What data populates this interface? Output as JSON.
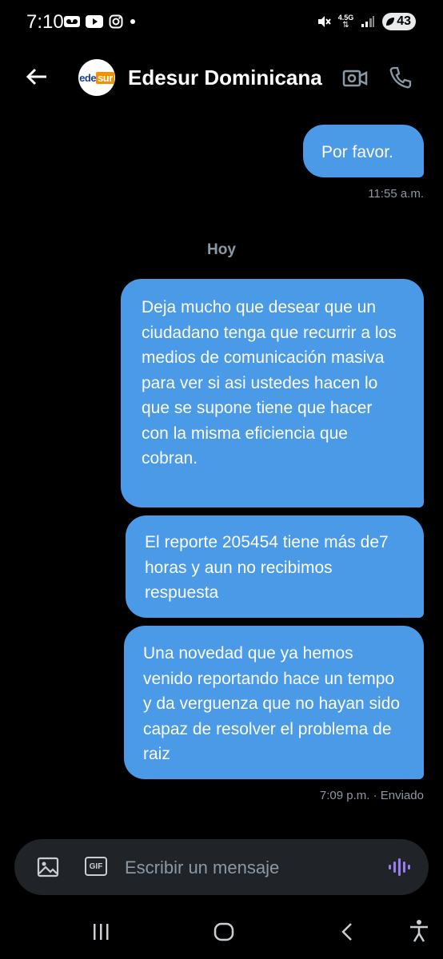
{
  "status_bar": {
    "time": "7:10",
    "network": "4.5G",
    "battery": "43",
    "icons": [
      "voicemail-icon",
      "youtube-icon",
      "instagram-icon",
      "dot-icon",
      "mute-icon",
      "signal-icon",
      "battery-icon"
    ]
  },
  "header": {
    "avatar_text_1": "ede",
    "avatar_text_2": "sur",
    "title": "Edesur Dominicana",
    "accent": "#f39200",
    "brand_blue": "#1f3f8f"
  },
  "messages": [
    {
      "text": "Por favor.",
      "meta": "11:55 a.m."
    },
    {
      "text": "Deja mucho que desear que un ciudadano tenga que recurrir a los medios de comunicación masiva para ver si asi ustedes hacen lo que se supone tiene que hacer con la misma eficiencia que cobran."
    },
    {
      "text": "El reporte 205454 tiene más de7 horas y aun no recibimos respuesta"
    },
    {
      "text": "Una novedad que ya hemos venido reportando  hace un tempo y da verguenza que no hayan sido capaz de resolver el problema de raiz",
      "meta": "7:09 p.m. · Enviado"
    }
  ],
  "day_separator": "Hoy",
  "composer": {
    "placeholder": "Escribir un mensaje",
    "gif_label": "GIF"
  },
  "colors": {
    "bubble": "#4a9ae8",
    "background": "#000000",
    "composer": "#202327",
    "voice": "#9b7cf0"
  }
}
